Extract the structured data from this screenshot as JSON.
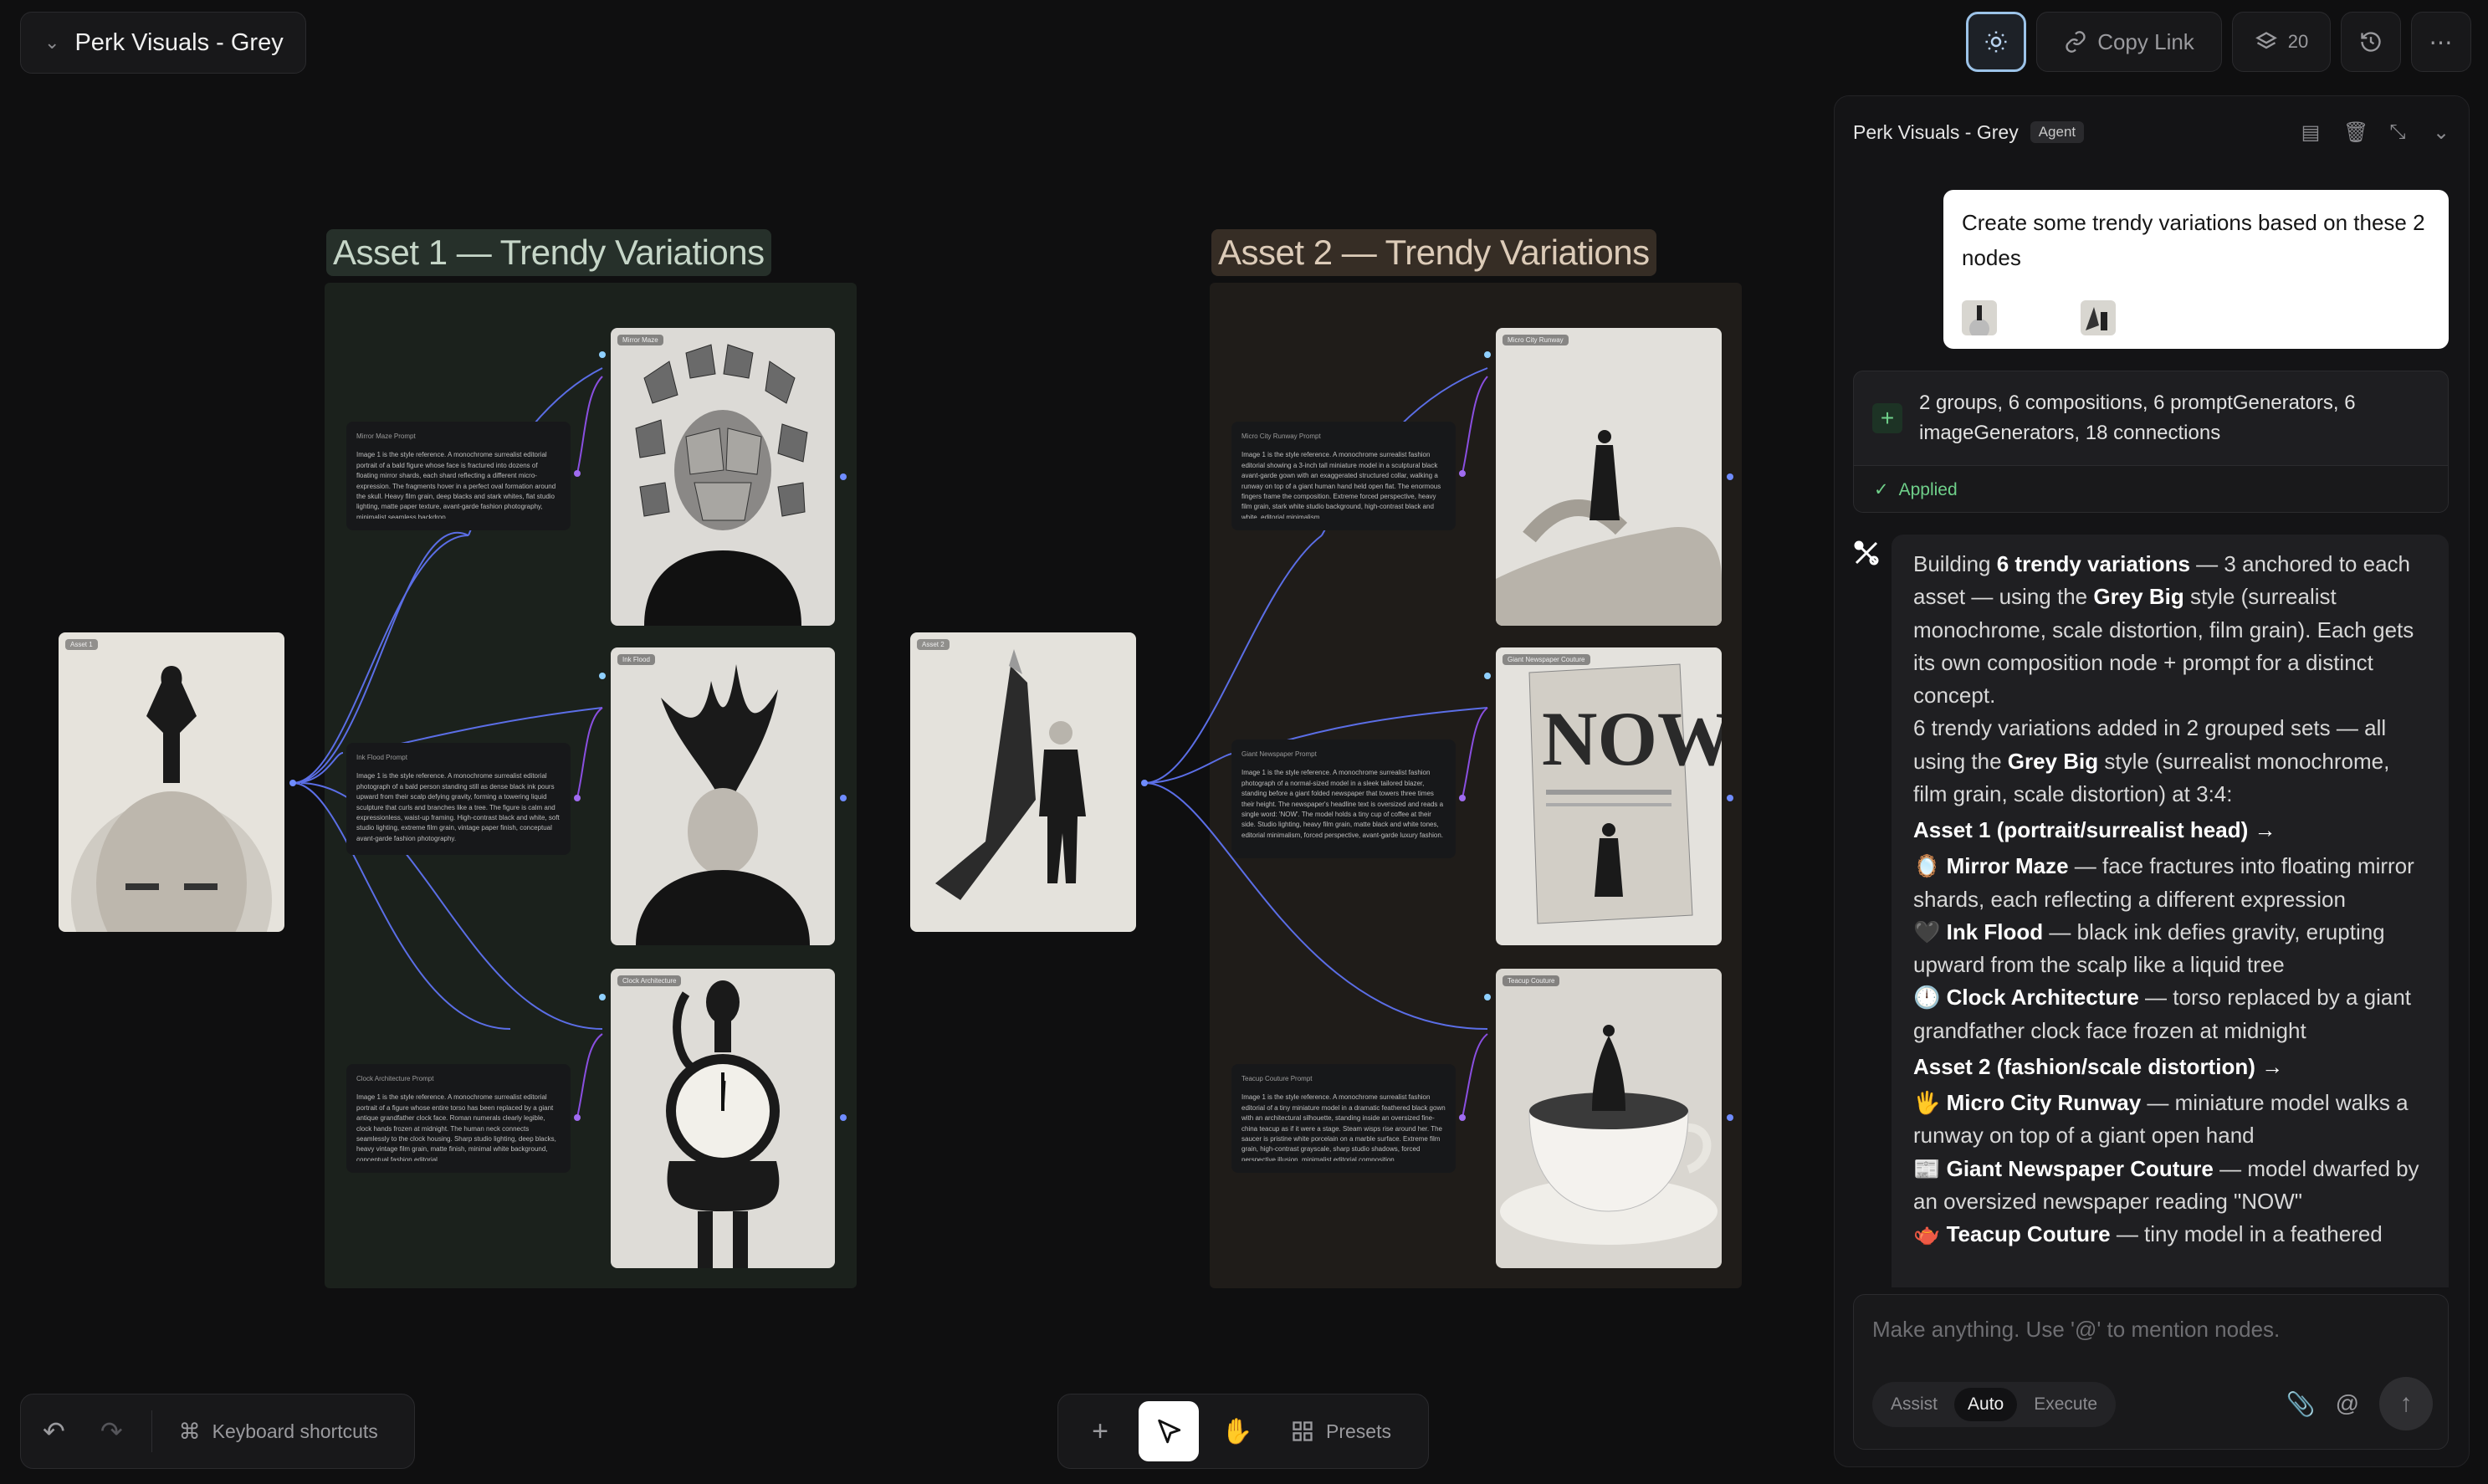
{
  "header": {
    "project_title": "Perk Visuals - Grey",
    "copy_link": "Copy Link",
    "layers_count": "20"
  },
  "canvas": {
    "group1_label": "Asset 1 — Trendy Variations",
    "group2_label": "Asset 2 — Trendy Variations",
    "asset1_tag": "Asset 1",
    "asset2_tag": "Asset 2",
    "group1": {
      "prompts": [
        {
          "title": "Mirror Maze Prompt",
          "body": "Image 1 is the style reference. A monochrome surrealist editorial portrait of a bald figure whose face is fractured into dozens of floating mirror shards, each shard reflecting a different micro-expression. The fragments hover in a perfect oval formation around the skull. Heavy film grain, deep blacks and stark whites, flat studio lighting, matte paper texture, avant-garde fashion photography, minimalist seamless backdrop."
        },
        {
          "title": "Ink Flood Prompt",
          "body": "Image 1 is the style reference. A monochrome surrealist editorial photograph of a bald person standing still as dense black ink pours upward from their scalp defying gravity, forming a towering liquid sculpture that curls and branches like a tree. The figure is calm and expressionless, waist-up framing. High-contrast black and white, soft studio lighting, extreme film grain, vintage paper finish, conceptual avant-garde fashion photography."
        },
        {
          "title": "Clock Architecture Prompt",
          "body": "Image 1 is the style reference. A monochrome surrealist editorial portrait of a figure whose entire torso has been replaced by a giant antique grandfather clock face. Roman numerals clearly legible, clock hands frozen at midnight. The human neck connects seamlessly to the clock housing. Sharp studio lighting, deep blacks, heavy vintage film grain, matte finish, minimal white background, conceptual fashion editorial."
        }
      ],
      "image_tags": [
        "Mirror Maze",
        "Ink Flood",
        "Clock Architecture"
      ]
    },
    "group2": {
      "prompts": [
        {
          "title": "Micro City Runway Prompt",
          "body": "Image 1 is the style reference. A monochrome surrealist fashion editorial showing a 3-inch tall miniature model in a sculptural black avant-garde gown with an exaggerated structured collar, walking a runway on top of a giant human hand held open flat. The enormous fingers frame the composition. Extreme forced perspective, heavy film grain, stark white studio background, high-contrast black and white, editorial minimalism."
        },
        {
          "title": "Giant Newspaper Prompt",
          "body": "Image 1 is the style reference. A monochrome surrealist fashion photograph of a normal-sized model in a sleek tailored blazer, standing before a giant folded newspaper that towers three times their height. The newspaper's headline text is oversized and reads a single word: 'NOW'. The model holds a tiny cup of coffee at their side. Studio lighting, heavy film grain, matte black and white tones, editorial minimalism, forced perspective, avant-garde luxury fashion."
        },
        {
          "title": "Teacup Couture Prompt",
          "body": "Image 1 is the style reference. A monochrome surrealist fashion editorial of a tiny miniature model in a dramatic feathered black gown with an architectural silhouette, standing inside an oversized fine-china teacup as if it were a stage. Steam wisps rise around her. The saucer is pristine white porcelain on a marble surface. Extreme film grain, high-contrast grayscale, sharp studio shadows, forced perspective illusion, minimalist editorial composition."
        }
      ],
      "image_tags": [
        "Micro City Runway",
        "Giant Newspaper Couture",
        "Teacup Couture"
      ]
    }
  },
  "toolbar": {
    "keyboard_shortcuts": "Keyboard shortcuts",
    "presets": "Presets"
  },
  "panel": {
    "title": "Perk Visuals - Grey",
    "badge": "Agent",
    "user_message": "Create some trendy variations based on these 2 nodes",
    "result_summary": "2 groups, 6 compositions, 6 promptGenerators, 6 imageGenerators, 18 connections",
    "applied": "Applied",
    "agent": {
      "p1_a": "Building ",
      "p1_b": "6 trendy variations",
      "p1_c": " — 3 anchored to each asset — using the ",
      "p1_d": "Grey Big",
      "p1_e": " style (surrealist monochrome, scale distortion, film grain). Each gets its own composition node + prompt for a distinct concept.",
      "p2_a": "6 trendy variations added in 2 grouped sets — all using the ",
      "p2_b": "Grey Big",
      "p2_c": " style (surrealist monochrome, film grain, scale distortion) at 3:4:",
      "h1": "Asset 1 (portrait/surrealist head) →",
      "items1": [
        {
          "emoji": "🪞",
          "name": "Mirror Maze",
          "desc": " — face fractures into floating mirror shards, each reflecting a different expression"
        },
        {
          "emoji": "🖤",
          "name": "Ink Flood",
          "desc": " — black ink defies gravity, erupting upward from the scalp like a liquid tree"
        },
        {
          "emoji": "🕛",
          "name": "Clock Architecture",
          "desc": " — torso replaced by a giant grandfather clock face frozen at midnight"
        }
      ],
      "h2": "Asset 2 (fashion/scale distortion) →",
      "items2": [
        {
          "emoji": "🖐",
          "name": "Micro City Runway",
          "desc": " — miniature model walks a runway on top of a giant open hand"
        },
        {
          "emoji": "📰",
          "name": "Giant Newspaper Couture",
          "desc": " — model dwarfed by an oversized newspaper reading \"NOW\""
        },
        {
          "emoji": "🫖",
          "name": "Teacup Couture",
          "desc": " — tiny model in a feathered"
        }
      ]
    },
    "input_placeholder": "Make anything. Use '@' to mention nodes.",
    "modes": [
      "Assist",
      "Auto",
      "Execute"
    ]
  },
  "colors": {
    "background": "#0f0f10",
    "group1_fill": "#1b211c",
    "group2_fill": "#1f1c19",
    "wire_blue": "#5b6ee6",
    "wire_purple": "#8a4fe0",
    "applied_green": "#6fd08a"
  }
}
